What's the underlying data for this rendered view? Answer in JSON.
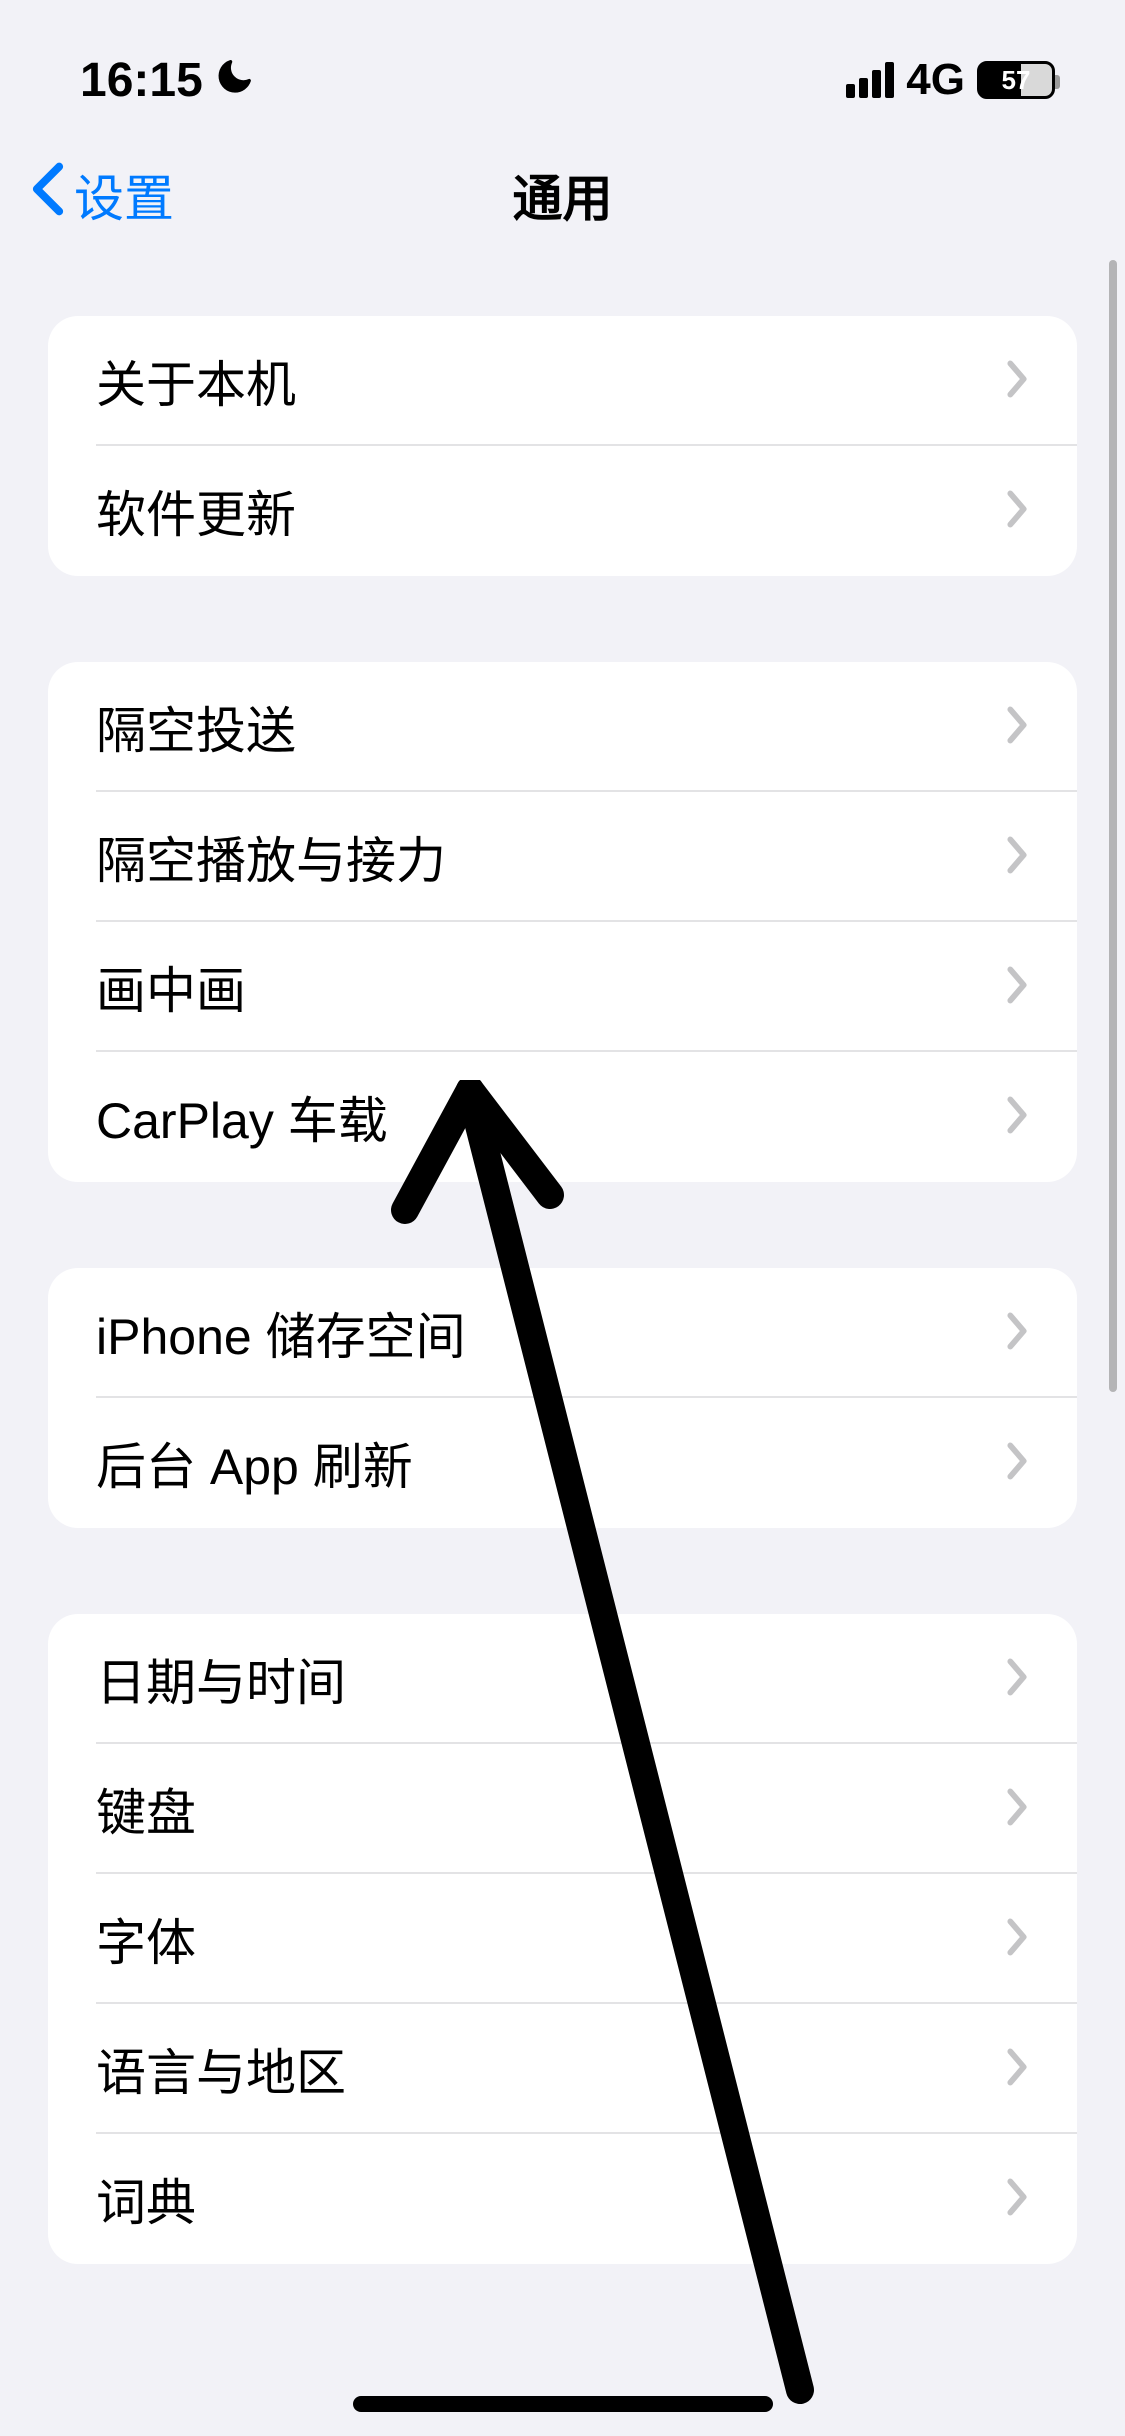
{
  "status": {
    "time": "16:15",
    "network": "4G",
    "battery": "57"
  },
  "nav": {
    "back_label": "设置",
    "title": "通用"
  },
  "sections": [
    {
      "rows": [
        {
          "label": "关于本机"
        },
        {
          "label": "软件更新"
        }
      ]
    },
    {
      "rows": [
        {
          "label": "隔空投送"
        },
        {
          "label": "隔空播放与接力"
        },
        {
          "label": "画中画"
        },
        {
          "label": "CarPlay 车载"
        }
      ]
    },
    {
      "rows": [
        {
          "label": "iPhone 储存空间"
        },
        {
          "label": "后台 App 刷新"
        }
      ]
    },
    {
      "rows": [
        {
          "label": "日期与时间"
        },
        {
          "label": "键盘"
        },
        {
          "label": "字体"
        },
        {
          "label": "语言与地区"
        },
        {
          "label": "词典"
        }
      ]
    }
  ]
}
